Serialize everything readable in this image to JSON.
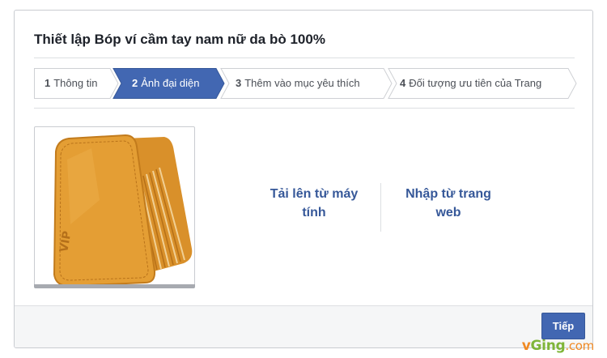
{
  "dialog": {
    "title": "Thiết lập Bóp ví cầm tay nam nữ da bò 100%"
  },
  "steps": [
    {
      "number": "1",
      "label": "Thông tin",
      "active": false
    },
    {
      "number": "2",
      "label": "Ảnh đại diện",
      "active": true
    },
    {
      "number": "3",
      "label": "Thêm vào mục yêu thích",
      "active": false
    },
    {
      "number": "4",
      "label": "Đối tượng ưu tiên của Trang",
      "active": false
    }
  ],
  "profile_photo": {
    "subject": "wallet-photo",
    "embossed_text": "VIP",
    "wallet_color": "#e0992f"
  },
  "actions": {
    "upload_label": "Tải lên từ máy tính",
    "import_label": "Nhập từ trang web"
  },
  "footer": {
    "next_label": "Tiếp"
  },
  "watermark": {
    "v": "v",
    "g": "Ging",
    "com": ".com"
  },
  "colors": {
    "active_step": "#4267b2",
    "link": "#365899",
    "primary_button": "#4267b2"
  }
}
